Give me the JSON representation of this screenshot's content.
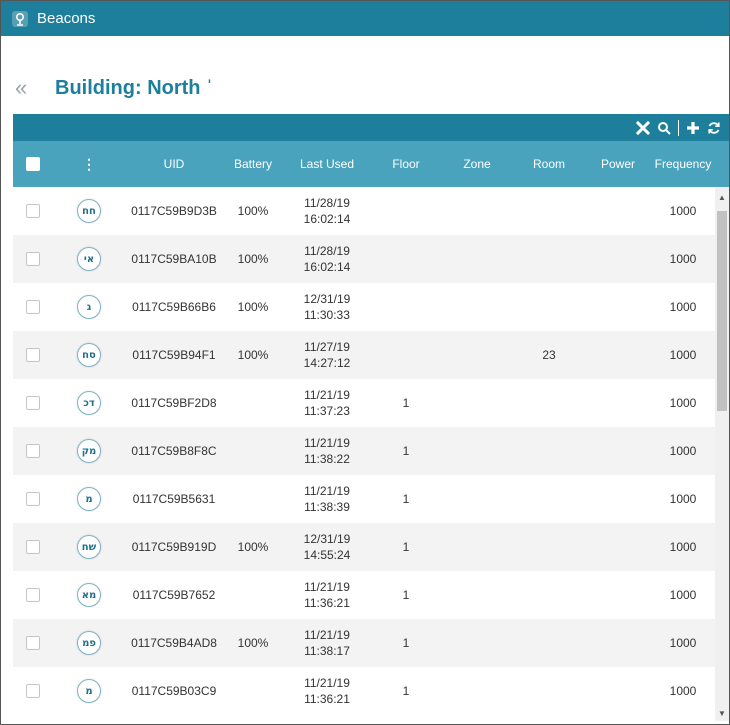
{
  "window": {
    "title": "Beacons",
    "icon": "beacon-icon"
  },
  "header": {
    "back_icon": "double-chevron-left-icon",
    "back_glyph": "«",
    "title": "Building: North ˈ"
  },
  "toolbar": {
    "icons": [
      "close-icon",
      "search-icon",
      "add-icon",
      "refresh-icon"
    ]
  },
  "colors": {
    "titlebar": "#1e7f9c",
    "toolbar": "#1e7f9c",
    "header_row": "#4aa3bd",
    "accent_text": "#1e7f9c"
  },
  "table": {
    "columns": {
      "menu": "⋮",
      "uid": "UID",
      "battery": "Battery",
      "last_used": "Last Used",
      "floor": "Floor",
      "zone": "Zone",
      "room": "Room",
      "power": "Power",
      "frequency": "Frequency"
    },
    "rows": [
      {
        "badge": "חח",
        "uid": "0117C59B9D3B",
        "battery": "100%",
        "date": "11/28/19",
        "time": "16:02:14",
        "floor": "",
        "zone": "",
        "room": "",
        "power": "",
        "frequency": "1000"
      },
      {
        "badge": "אי",
        "uid": "0117C59BA10B",
        "battery": "100%",
        "date": "11/28/19",
        "time": "16:02:14",
        "floor": "",
        "zone": "",
        "room": "",
        "power": "",
        "frequency": "1000"
      },
      {
        "badge": "ג",
        "uid": "0117C59B66B6",
        "battery": "100%",
        "date": "12/31/19",
        "time": "11:30:33",
        "floor": "",
        "zone": "",
        "room": "",
        "power": "",
        "frequency": "1000"
      },
      {
        "badge": "סח",
        "uid": "0117C59B94F1",
        "battery": "100%",
        "date": "11/27/19",
        "time": "14:27:12",
        "floor": "",
        "zone": "",
        "room": "23",
        "power": "",
        "frequency": "1000"
      },
      {
        "badge": "דכ",
        "uid": "0117C59BF2D8",
        "battery": "",
        "date": "11/21/19",
        "time": "11:37:23",
        "floor": "1",
        "zone": "",
        "room": "",
        "power": "",
        "frequency": "1000"
      },
      {
        "badge": "מק",
        "uid": "0117C59B8F8C",
        "battery": "",
        "date": "11/21/19",
        "time": "11:38:22",
        "floor": "1",
        "zone": "",
        "room": "",
        "power": "",
        "frequency": "1000"
      },
      {
        "badge": "מ",
        "uid": "0117C59B5631",
        "battery": "",
        "date": "11/21/19",
        "time": "11:38:39",
        "floor": "1",
        "zone": "",
        "room": "",
        "power": "",
        "frequency": "1000"
      },
      {
        "badge": "שח",
        "uid": "0117C59B919D",
        "battery": "100%",
        "date": "12/31/19",
        "time": "14:55:24",
        "floor": "1",
        "zone": "",
        "room": "",
        "power": "",
        "frequency": "1000"
      },
      {
        "badge": "מא",
        "uid": "0117C59B7652",
        "battery": "",
        "date": "11/21/19",
        "time": "11:36:21",
        "floor": "1",
        "zone": "",
        "room": "",
        "power": "",
        "frequency": "1000"
      },
      {
        "badge": "פמ",
        "uid": "0117C59B4AD8",
        "battery": "100%",
        "date": "11/21/19",
        "time": "11:38:17",
        "floor": "1",
        "zone": "",
        "room": "",
        "power": "",
        "frequency": "1000"
      },
      {
        "badge": "מ",
        "uid": "0117C59B03C9",
        "battery": "",
        "date": "11/21/19",
        "time": "11:36:21",
        "floor": "1",
        "zone": "",
        "room": "",
        "power": "",
        "frequency": "1000"
      }
    ]
  }
}
